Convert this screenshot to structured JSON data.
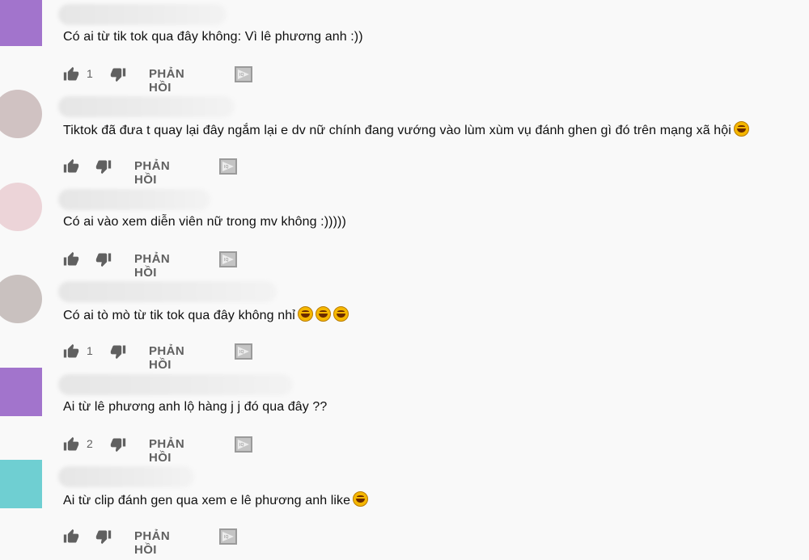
{
  "comments": [
    {
      "text": "Có ai từ tik tok qua đây không: Vì lê phương anh :))",
      "like_count": "1",
      "reply_label": "PHẢN HỒI",
      "emoji_count": 0,
      "avatar_color": "#a274cc"
    },
    {
      "text": "Tiktok đã đưa t quay lại đây ngắm lại e dv nữ chính đang vướng vào lùm xùm vụ đánh ghen gì đó trên mạng xã hội",
      "like_count": "",
      "reply_label": "PHẢN HỒI",
      "emoji_count": 1,
      "avatar_color": "#d0c2c2"
    },
    {
      "text": "Có ai vào xem diễn viên nữ trong mv không :)))))",
      "like_count": "",
      "reply_label": "PHẢN HỒI",
      "emoji_count": 0,
      "avatar_color": "#ecd4d8"
    },
    {
      "text": "Có ai tò mò từ tik tok qua đây không nhỉ",
      "like_count": "1",
      "reply_label": "PHẢN HỒI",
      "emoji_count": 3,
      "avatar_color": "#c9c1bf"
    },
    {
      "text": "Ai từ lê phương anh lộ hàng j j đó qua đây ??",
      "like_count": "2",
      "reply_label": "PHẢN HỒI",
      "emoji_count": 0,
      "avatar_color": "#a274cc"
    },
    {
      "text": "Ai từ clip đánh gen qua xem e lê phương anh like",
      "like_count": "",
      "reply_label": "PHẢN HỒI",
      "emoji_count": 1,
      "avatar_color": "#6fcfd2"
    }
  ],
  "icons": {
    "like": "thumb-up-icon",
    "dislike": "thumb-down-icon",
    "reply_badge": "reply-badge-icon"
  },
  "colors": {
    "background": "#f9f9f9",
    "text": "#0f0f0f",
    "secondary_text": "#606060"
  }
}
